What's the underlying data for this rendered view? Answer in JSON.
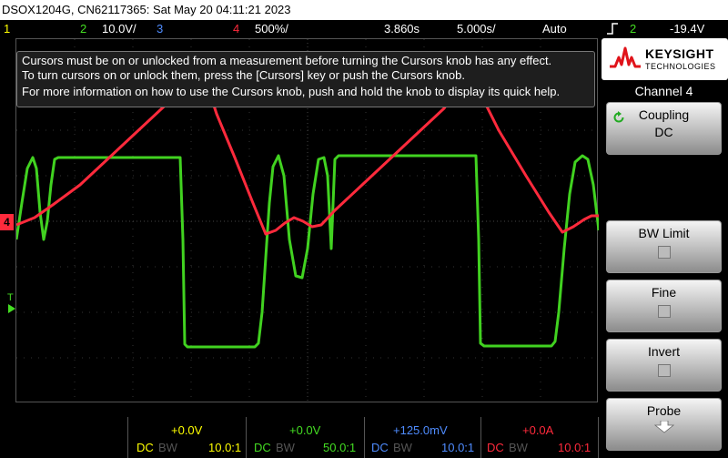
{
  "titlebar": {
    "text": "DSOX1204G, CN62117365: Sat May 20 04:11:21 2023"
  },
  "status": {
    "ch1_num": "1",
    "ch2_num": "2",
    "ch2_scale": "10.0V/",
    "ch3_num": "3",
    "ch4_num": "4",
    "ch4_scale": "500%/",
    "time_offset": "3.860s",
    "timebase": "5.000s/",
    "trigger_mode": "Auto",
    "trig_channel": "2",
    "trig_level": "-19.4V"
  },
  "message": {
    "line1": "Cursors must be on or unlocked from a measurement before turning the Cursors knob has any effect.",
    "line2": "To turn cursors on or unlock them, press the [Cursors] key or push the Cursors knob.",
    "line3": "For more information on how to use the Cursors knob, push and hold the knob to display its quick help."
  },
  "logo": {
    "brand": "KEYSIGHT",
    "sub": "TECHNOLOGIES"
  },
  "panel": {
    "title": "Channel 4",
    "coupling_label": "Coupling",
    "coupling_value": "DC",
    "bwlimit_label": "BW Limit",
    "fine_label": "Fine",
    "invert_label": "Invert",
    "probe_label": "Probe"
  },
  "markers": {
    "ch4": "4",
    "trigger": "T"
  },
  "channels": [
    {
      "offset": "+0.0V",
      "coupling": "DC",
      "bw": "BW",
      "probe": "10.0:1",
      "color": "#ffff00"
    },
    {
      "offset": "+0.0V",
      "coupling": "DC",
      "bw": "BW",
      "probe": "50.0:1",
      "color": "#44dd22"
    },
    {
      "offset": "+125.0mV",
      "coupling": "DC",
      "bw": "BW",
      "probe": "10.0:1",
      "color": "#4f8cff"
    },
    {
      "offset": "+0.0A",
      "coupling": "DC",
      "bw": "BW",
      "probe": "10.0:1",
      "color": "#ff2a3c"
    }
  ],
  "colors": {
    "ch1": "#ffff00",
    "ch2": "#44dd22",
    "ch3": "#4f8cff",
    "ch4": "#ff2a3c",
    "trigger_marker": "#ff9900"
  }
}
